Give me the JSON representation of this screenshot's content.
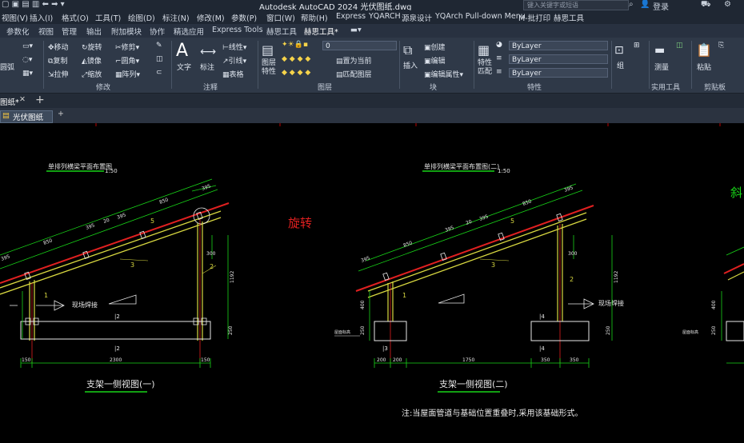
{
  "titlebar": {
    "app_title": "Autodesk AutoCAD 2024    光伏图纸.dwg",
    "search_placeholder": "键入关键字或短语",
    "login": "登录"
  },
  "menubar": [
    "视图(V)",
    "插入(I)",
    "格式(O)",
    "工具(T)",
    "绘图(D)",
    "标注(N)",
    "修改(M)",
    "参数(P)",
    "窗口(W)",
    "帮助(H)",
    "Express",
    "YQARCH",
    "源泉设计",
    "YQArch Pull-down Menu",
    "M-批打印",
    "赫思工具"
  ],
  "ribbon_tabs": [
    "参数化",
    "视图",
    "管理",
    "输出",
    "附加模块",
    "协作",
    "精选应用",
    "Express Tools",
    "赫思工具",
    "赫思工具*"
  ],
  "ribbon": {
    "draw": {
      "arc": "圆弧"
    },
    "modify": {
      "move": "移动",
      "rotate": "旋转",
      "trim": "修剪",
      "copy": "复制",
      "mirror": "镜像",
      "fillet": "圆角",
      "stretch": "拉伸",
      "scale": "缩放",
      "array": "阵列",
      "label": "修改"
    },
    "annotation": {
      "text": "文字",
      "dim": "标注",
      "linear": "线性",
      "leader": "引线",
      "table": "表格",
      "label": "注释"
    },
    "layers": {
      "props": "图层\n特性",
      "current_layer": "0",
      "set_current": "置为当前",
      "match_layer": "匹配图层",
      "label": "图层"
    },
    "block": {
      "insert": "插入",
      "create": "创建",
      "edit": "编辑",
      "edit_attr": "编辑属性",
      "label": "块"
    },
    "properties": {
      "match": "特性\n匹配",
      "color": "ByLayer",
      "linetype": "ByLayer",
      "lineweight": "ByLayer",
      "label": "特性"
    },
    "groups": {
      "group": "组"
    },
    "utilities": {
      "measure": "测量",
      "label": "实用工具"
    },
    "clipboard": {
      "paste": "粘贴",
      "label": "剪贴板"
    }
  },
  "file_tabs": {
    "current": "图纸*"
  },
  "doc_tab": {
    "name": "光伏图纸"
  },
  "drawing": {
    "title1": "单排列横梁平面布置图",
    "title2": "单排列横梁平面布置图(二)",
    "scale": "1:50",
    "rotate_note": "旋转",
    "right_cut": "斜",
    "view1_caption": "支架一侧视图(一)",
    "view2_caption": "支架一侧视图(二)",
    "weld": "现场焊接",
    "note": "注:当屋面管道与基础位置重叠时,采用该基础形式。",
    "roof_label": "屋面标高",
    "dims1": {
      "a": "395",
      "b": "850",
      "c": "395",
      "d": "20",
      "e": "395",
      "f": "850",
      "g": "395",
      "h": "300",
      "i": "1192",
      "j": "250",
      "base1": "150",
      "base2": "2300",
      "base3": "150"
    },
    "dims2": {
      "base1": "200",
      "base2": "200",
      "base3": "1750",
      "base4": "350",
      "base5": "350",
      "h400": "400",
      "h250": "250"
    },
    "marks": [
      "1",
      "2",
      "3",
      "4",
      "5"
    ]
  },
  "colors": {
    "bg": "#000000",
    "green": "#18d418",
    "yellow": "#d8d840",
    "red": "#e02020",
    "white": "#e8e8e8"
  }
}
